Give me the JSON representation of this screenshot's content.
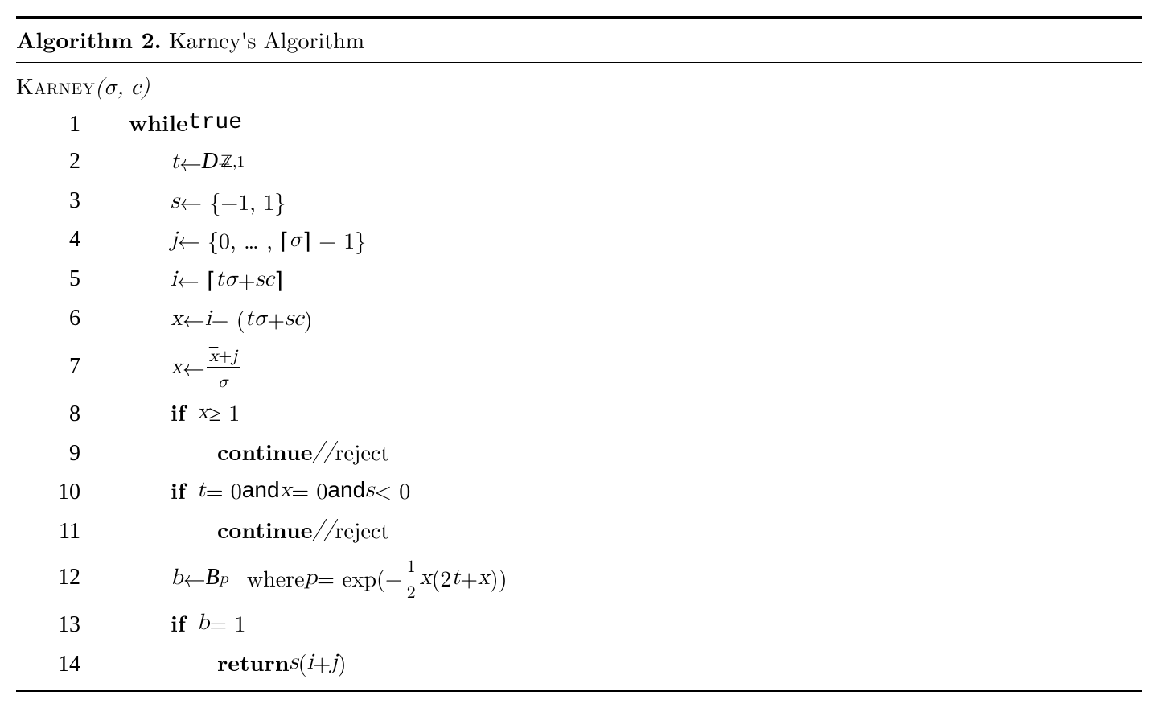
{
  "header": {
    "label": "Algorithm 2.",
    "title": "Karney's Algorithm"
  },
  "func": {
    "name": "Karney",
    "args": "(σ, c)"
  },
  "lines": [
    {
      "n": "1",
      "indent": "indent1",
      "html": "<span class='kw'>while</span> <span class='tt'>true</span>"
    },
    {
      "n": "2",
      "indent": "indent2",
      "html": "<span class='math'>t</span> ← <span class='script'>D</span><sup>+</sup><sub style='margin-left:-12px;'><span class='bb'>ℤ</span>,1</sub>"
    },
    {
      "n": "3",
      "indent": "indent2",
      "html": "<span class='math'>s</span> ← {−1, 1}"
    },
    {
      "n": "4",
      "indent": "indent2",
      "html": "<span class='math'>j</span> ← {0, … , ⌈<span class='math'>σ</span>⌉ − 1}"
    },
    {
      "n": "5",
      "indent": "indent2",
      "html": "<span class='math'>i</span> ← ⌈<span class='math'>tσ</span> + <span class='math'>sc</span>⌉"
    },
    {
      "n": "6",
      "indent": "indent2",
      "html": "<span class='math bar'>x</span> ← <span class='math'>i</span> − (<span class='math'>tσ</span> + <span class='math'>sc</span>)"
    },
    {
      "n": "7",
      "indent": "indent2",
      "html": "<span class='math'>x</span> ← <span class='frac'><span class='frac-num'><span class='math bar'>x</span>+<span class='math'>j</span></span><span class='frac-den'><span class='math'>σ</span></span></span>"
    },
    {
      "n": "8",
      "indent": "indent2",
      "html": "<span class='kw'>if</span>&nbsp; <span class='math'>x</span> ≥ 1"
    },
    {
      "n": "9",
      "indent": "indent3",
      "html": "<span class='kw'>continue</span> <span class='math'>//</span> reject"
    },
    {
      "n": "10",
      "indent": "indent2",
      "html": "<span class='kw'>if</span>&nbsp; <span class='math'>t</span> = 0 <span class='sf'>and</span> <span class='math'>x</span> = 0 <span class='sf'>and</span> <span class='math'>s</span> &lt; 0"
    },
    {
      "n": "11",
      "indent": "indent3",
      "html": "<span class='kw'>continue</span> <span class='math'>//</span> reject"
    },
    {
      "n": "12",
      "indent": "indent2",
      "html": "<span class='math'>b</span> ← <span class='script'>B</span><sub><span class='math'>p</span></sub>&nbsp; where <span class='math'>p</span> = exp(−<span class='frac'><span class='frac-num'>1</span><span class='frac-den'>2</span></span><span class='math'>x</span>(2<span class='math'>t</span> + <span class='math'>x</span>))"
    },
    {
      "n": "13",
      "indent": "indent2",
      "html": "<span class='kw'>if</span>&nbsp; <span class='math'>b</span> = 1"
    },
    {
      "n": "14",
      "indent": "indent3",
      "html": "<span class='kw'>return</span> <span class='math'>s</span>(<span class='math'>i</span> + <span class='math'>j</span>)"
    }
  ]
}
